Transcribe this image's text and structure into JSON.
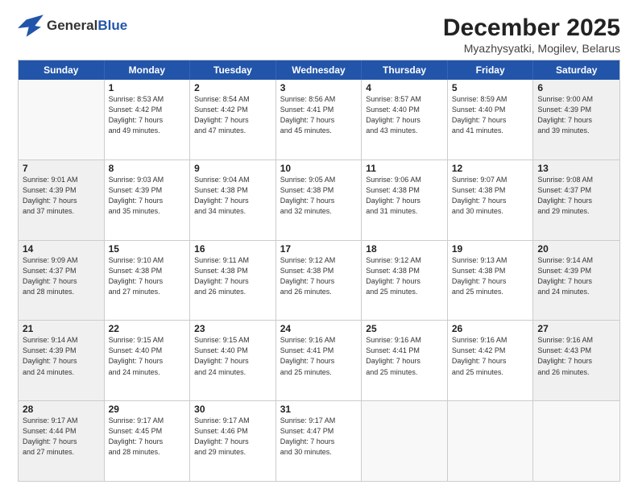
{
  "header": {
    "logo_general": "General",
    "logo_blue": "Blue",
    "month_title": "December 2025",
    "location": "Myazhysyatki, Mogilev, Belarus"
  },
  "weekdays": [
    "Sunday",
    "Monday",
    "Tuesday",
    "Wednesday",
    "Thursday",
    "Friday",
    "Saturday"
  ],
  "rows": [
    [
      {
        "day": "",
        "info": ""
      },
      {
        "day": "1",
        "info": "Sunrise: 8:53 AM\nSunset: 4:42 PM\nDaylight: 7 hours\nand 49 minutes."
      },
      {
        "day": "2",
        "info": "Sunrise: 8:54 AM\nSunset: 4:42 PM\nDaylight: 7 hours\nand 47 minutes."
      },
      {
        "day": "3",
        "info": "Sunrise: 8:56 AM\nSunset: 4:41 PM\nDaylight: 7 hours\nand 45 minutes."
      },
      {
        "day": "4",
        "info": "Sunrise: 8:57 AM\nSunset: 4:40 PM\nDaylight: 7 hours\nand 43 minutes."
      },
      {
        "day": "5",
        "info": "Sunrise: 8:59 AM\nSunset: 4:40 PM\nDaylight: 7 hours\nand 41 minutes."
      },
      {
        "day": "6",
        "info": "Sunrise: 9:00 AM\nSunset: 4:39 PM\nDaylight: 7 hours\nand 39 minutes."
      }
    ],
    [
      {
        "day": "7",
        "info": "Sunrise: 9:01 AM\nSunset: 4:39 PM\nDaylight: 7 hours\nand 37 minutes."
      },
      {
        "day": "8",
        "info": "Sunrise: 9:03 AM\nSunset: 4:39 PM\nDaylight: 7 hours\nand 35 minutes."
      },
      {
        "day": "9",
        "info": "Sunrise: 9:04 AM\nSunset: 4:38 PM\nDaylight: 7 hours\nand 34 minutes."
      },
      {
        "day": "10",
        "info": "Sunrise: 9:05 AM\nSunset: 4:38 PM\nDaylight: 7 hours\nand 32 minutes."
      },
      {
        "day": "11",
        "info": "Sunrise: 9:06 AM\nSunset: 4:38 PM\nDaylight: 7 hours\nand 31 minutes."
      },
      {
        "day": "12",
        "info": "Sunrise: 9:07 AM\nSunset: 4:38 PM\nDaylight: 7 hours\nand 30 minutes."
      },
      {
        "day": "13",
        "info": "Sunrise: 9:08 AM\nSunset: 4:37 PM\nDaylight: 7 hours\nand 29 minutes."
      }
    ],
    [
      {
        "day": "14",
        "info": "Sunrise: 9:09 AM\nSunset: 4:37 PM\nDaylight: 7 hours\nand 28 minutes."
      },
      {
        "day": "15",
        "info": "Sunrise: 9:10 AM\nSunset: 4:38 PM\nDaylight: 7 hours\nand 27 minutes."
      },
      {
        "day": "16",
        "info": "Sunrise: 9:11 AM\nSunset: 4:38 PM\nDaylight: 7 hours\nand 26 minutes."
      },
      {
        "day": "17",
        "info": "Sunrise: 9:12 AM\nSunset: 4:38 PM\nDaylight: 7 hours\nand 26 minutes."
      },
      {
        "day": "18",
        "info": "Sunrise: 9:12 AM\nSunset: 4:38 PM\nDaylight: 7 hours\nand 25 minutes."
      },
      {
        "day": "19",
        "info": "Sunrise: 9:13 AM\nSunset: 4:38 PM\nDaylight: 7 hours\nand 25 minutes."
      },
      {
        "day": "20",
        "info": "Sunrise: 9:14 AM\nSunset: 4:39 PM\nDaylight: 7 hours\nand 24 minutes."
      }
    ],
    [
      {
        "day": "21",
        "info": "Sunrise: 9:14 AM\nSunset: 4:39 PM\nDaylight: 7 hours\nand 24 minutes."
      },
      {
        "day": "22",
        "info": "Sunrise: 9:15 AM\nSunset: 4:40 PM\nDaylight: 7 hours\nand 24 minutes."
      },
      {
        "day": "23",
        "info": "Sunrise: 9:15 AM\nSunset: 4:40 PM\nDaylight: 7 hours\nand 24 minutes."
      },
      {
        "day": "24",
        "info": "Sunrise: 9:16 AM\nSunset: 4:41 PM\nDaylight: 7 hours\nand 25 minutes."
      },
      {
        "day": "25",
        "info": "Sunrise: 9:16 AM\nSunset: 4:41 PM\nDaylight: 7 hours\nand 25 minutes."
      },
      {
        "day": "26",
        "info": "Sunrise: 9:16 AM\nSunset: 4:42 PM\nDaylight: 7 hours\nand 25 minutes."
      },
      {
        "day": "27",
        "info": "Sunrise: 9:16 AM\nSunset: 4:43 PM\nDaylight: 7 hours\nand 26 minutes."
      }
    ],
    [
      {
        "day": "28",
        "info": "Sunrise: 9:17 AM\nSunset: 4:44 PM\nDaylight: 7 hours\nand 27 minutes."
      },
      {
        "day": "29",
        "info": "Sunrise: 9:17 AM\nSunset: 4:45 PM\nDaylight: 7 hours\nand 28 minutes."
      },
      {
        "day": "30",
        "info": "Sunrise: 9:17 AM\nSunset: 4:46 PM\nDaylight: 7 hours\nand 29 minutes."
      },
      {
        "day": "31",
        "info": "Sunrise: 9:17 AM\nSunset: 4:47 PM\nDaylight: 7 hours\nand 30 minutes."
      },
      {
        "day": "",
        "info": ""
      },
      {
        "day": "",
        "info": ""
      },
      {
        "day": "",
        "info": ""
      }
    ]
  ]
}
